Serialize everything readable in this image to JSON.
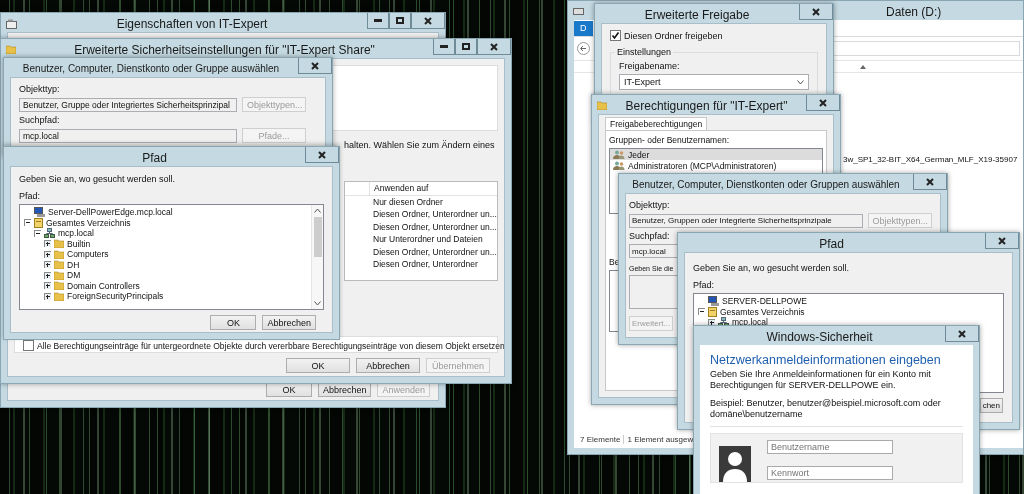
{
  "properties_window": {
    "title": "Eigenschaften von IT-Expert",
    "buttons": [
      {
        "label": "OK",
        "disabled": false
      },
      {
        "label": "Abbrechen",
        "disabled": false
      },
      {
        "label": "Anwenden",
        "disabled": true
      }
    ]
  },
  "advanced_security_window": {
    "title": "Erweiterte Sicherheitseinstellungen für \"IT-Expert Share\"",
    "hint": "halten. Wählen Sie zum Ändern eines",
    "table": {
      "columns": [
        "Anwenden auf"
      ],
      "rows": [
        "Nur diesen Ordner",
        "Diesen Ordner, Unterordner un...",
        "Diesen Ordner, Unterordner un...",
        "Nur Unterordner und Dateien",
        "Diesen Ordner, Unterordner un...",
        "Diesen Ordner, Unterordner"
      ]
    },
    "replace_checkbox": {
      "label": "Alle Berechtigungseinträge für untergeordnete Objekte durch vererbbare Berechtigungseinträge von diesem Objekt ersetzen",
      "checked": false
    },
    "buttons": [
      {
        "label": "OK",
        "disabled": false
      },
      {
        "label": "Abbrechen",
        "disabled": false
      },
      {
        "label": "Übernehmen",
        "disabled": true
      }
    ]
  },
  "select_dialog_left": {
    "title": "Benutzer, Computer, Dienstkonto oder Gruppe auswählen",
    "object_type_label": "Objekttyp:",
    "object_type": "Benutzer, Gruppe oder Integriertes Sicherheitsprinzipal",
    "object_types_button": {
      "label": "Objekttypen...",
      "disabled": true
    },
    "search_path_label": "Suchpfad:",
    "search_path": "mcp.local",
    "paths_button": {
      "label": "Pfade...",
      "disabled": true
    }
  },
  "path_dialog_left": {
    "title": "Pfad",
    "instruction": "Geben Sie an, wo gesucht werden soll.",
    "tree_label": "Pfad:",
    "tree": [
      {
        "label": "Server-DellPowerEdge.mcp.local",
        "kind": "computer"
      },
      {
        "label": "Gesamtes Verzeichnis",
        "kind": "directory",
        "expanded": true,
        "children": [
          {
            "label": "mcp.local",
            "kind": "domain",
            "expanded": true,
            "children": [
              {
                "label": "Builtin",
                "kind": "folder",
                "expanded": false
              },
              {
                "label": "Computers",
                "kind": "folder",
                "expanded": false
              },
              {
                "label": "DH",
                "kind": "folder",
                "expanded": false
              },
              {
                "label": "DM",
                "kind": "folder",
                "expanded": false
              },
              {
                "label": "Domain Controllers",
                "kind": "folder",
                "expanded": false
              },
              {
                "label": "ForeignSecurityPrincipals",
                "kind": "folder",
                "expanded": false
              }
            ]
          }
        ]
      }
    ],
    "buttons": [
      {
        "label": "OK",
        "disabled": false
      },
      {
        "label": "Abbrechen",
        "disabled": false
      }
    ]
  },
  "explorer_window": {
    "title": "Daten (D:)",
    "ribbon_tab": "D",
    "file_name": "3w_SP1_32-BIT_X64_German_MLF_X19-35907",
    "status": [
      "7 Elemente",
      "1 Element ausgew"
    ]
  },
  "advanced_sharing_window": {
    "title": "Erweiterte Freigabe",
    "share_checkbox": {
      "label": "Diesen Ordner freigeben",
      "checked": true
    },
    "group_label": "Einstellungen",
    "share_name_label": "Freigabename:",
    "share_name": "IT-Expert"
  },
  "permissions_window": {
    "title": "Berechtigungen für \"IT-Expert\"",
    "tabs": [
      {
        "label": "Freigabeberechtigungen",
        "selected": true
      }
    ],
    "names_label": "Gruppen- oder Benutzernamen:",
    "names": [
      {
        "label": "Jeder",
        "selected": true
      },
      {
        "label": "Administratoren (MCP\\Administratoren)",
        "selected": false
      }
    ],
    "permissions_label": "Be"
  },
  "select_dialog_right": {
    "title": "Benutzer, Computer, Dienstkonten oder Gruppen auswählen",
    "object_type_label": "Objekttyp:",
    "object_type": "Benutzer, Gruppen oder Integrierte Sicherheitsprinzipale",
    "object_types_button": {
      "label": "Objekttypen...",
      "disabled": true
    },
    "search_path_label": "Suchpfad:",
    "search_path": "mcp.local",
    "names_label": "Geben Sie die",
    "advanced_button": {
      "label": "Erweitert...",
      "disabled": true
    }
  },
  "path_dialog_right": {
    "title": "Pfad",
    "instruction": "Geben Sie an, wo gesucht werden soll.",
    "tree_label": "Pfad:",
    "tree": [
      {
        "label": "SERVER-DELLPOWE",
        "kind": "computer"
      },
      {
        "label": "Gesamtes Verzeichnis",
        "kind": "directory",
        "expanded": true,
        "children": [
          {
            "label": "mcp.local",
            "kind": "domain",
            "expanded": false
          }
        ]
      }
    ],
    "buttons": [
      {
        "label": "chen",
        "disabled": false
      }
    ]
  },
  "security_window": {
    "title": "Windows-Sicherheit",
    "heading": "Netzwerkanmeldeinformationen eingeben",
    "description": "Geben Sie Ihre Anmeldeinformationen für ein Konto mit Berechtigungen für SERVER-DELLPOWE ein.",
    "example": "Beispiel: Benutzer, benutzer@beispiel.microsoft.com oder domäne\\benutzername",
    "username": {
      "placeholder": "Benutzername"
    },
    "password": {
      "placeholder": "Kennwort"
    }
  }
}
